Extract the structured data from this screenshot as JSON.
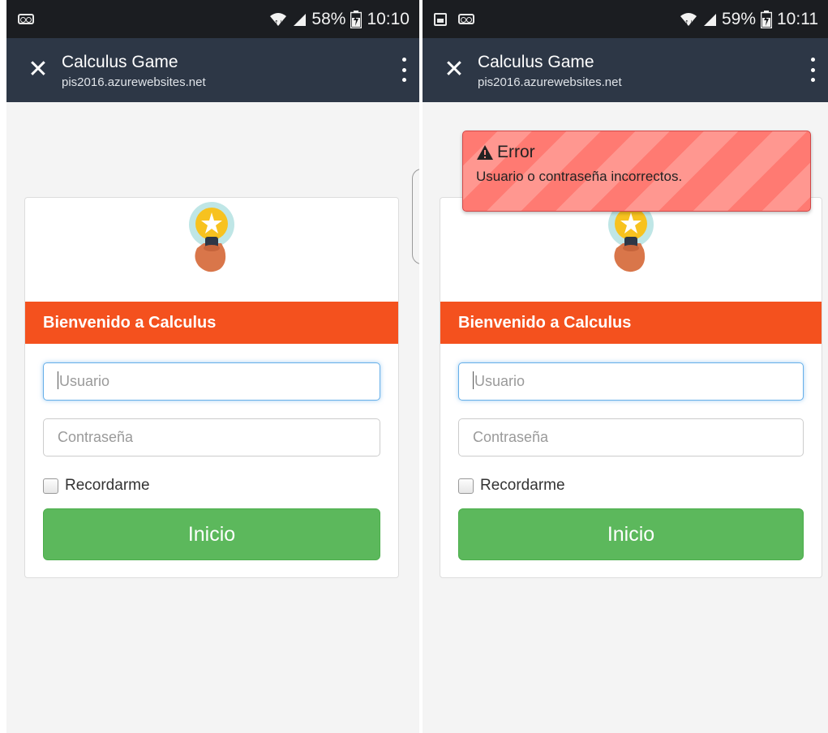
{
  "left": {
    "status": {
      "battery": "58%",
      "time": "10:10"
    },
    "toolbar": {
      "title": "Calculus Game",
      "url": "pis2016.azurewebsites.net"
    },
    "card": {
      "header": "Bienvenido a Calculus",
      "username_placeholder": "Usuario",
      "password_placeholder": "Contraseña",
      "remember_label": "Recordarme",
      "submit_label": "Inicio"
    }
  },
  "right": {
    "status": {
      "battery": "59%",
      "time": "10:11"
    },
    "toolbar": {
      "title": "Calculus Game",
      "url": "pis2016.azurewebsites.net"
    },
    "toast": {
      "title": "Error",
      "message": "Usuario o contraseña incorrectos."
    },
    "card": {
      "header": "Bienvenido a Calculus",
      "username_placeholder": "Usuario",
      "password_placeholder": "Contraseña",
      "remember_label": "Recordarme",
      "submit_label": "Inicio"
    }
  },
  "colors": {
    "toolbar": "#2d3746",
    "header": "#f4511e",
    "button": "#5cb85c",
    "toast": "#ff7a72"
  },
  "icons": [
    "voicemail-icon",
    "gallery-icon",
    "wifi-icon",
    "signal-icon",
    "battery-icon",
    "close-icon",
    "more-vert-icon",
    "lightbulb-logo",
    "warning-icon"
  ]
}
